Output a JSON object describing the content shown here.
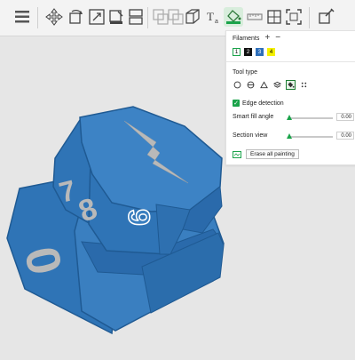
{
  "toolbar": {
    "icons": [
      "menu-icon",
      "move-icon",
      "rotate-icon",
      "scale-icon",
      "lay-on-face-icon",
      "cut-icon",
      "boolean-icon",
      "cube-icon",
      "support-painting-icon",
      "text-icon",
      "paint-bucket-icon",
      "measure-icon",
      "assembly-icon",
      "seam-painting-icon",
      "variable-layer-icon"
    ]
  },
  "panel": {
    "filaments_label": "Filaments",
    "add_symbol": "+",
    "remove_symbol": "−",
    "filaments": [
      {
        "label": "1",
        "color": "#ffffff",
        "text_color": "#000000",
        "selected": true
      },
      {
        "label": "2",
        "color": "#111111",
        "text_color": "#ffffff",
        "selected": false
      },
      {
        "label": "3",
        "color": "#2e6fba",
        "text_color": "#ffffff",
        "selected": false
      },
      {
        "label": "4",
        "color": "#f4f000",
        "text_color": "#000000",
        "selected": false
      }
    ],
    "tool_type_label": "Tool type",
    "tools": [
      "circle-brush",
      "sphere-brush",
      "triangle-brush",
      "height-range",
      "fill-bucket",
      "gap-fill"
    ],
    "selected_tool": "fill-bucket",
    "edge_detection_label": "Edge detection",
    "edge_detection_checked": true,
    "smart_fill_label": "Smart fill angle",
    "smart_fill_value": "0.00",
    "section_view_label": "Section view",
    "section_view_value": "0.00",
    "erase_label": "Erase all painting"
  },
  "model": {
    "colors": {
      "body": "#2f74b6",
      "dark": "#1f5a93",
      "light": "#4a8fd0",
      "decal": "#b9b9b9"
    },
    "numbers": [
      "0",
      "7",
      "8",
      "9"
    ]
  },
  "accent": "#1aa34a"
}
